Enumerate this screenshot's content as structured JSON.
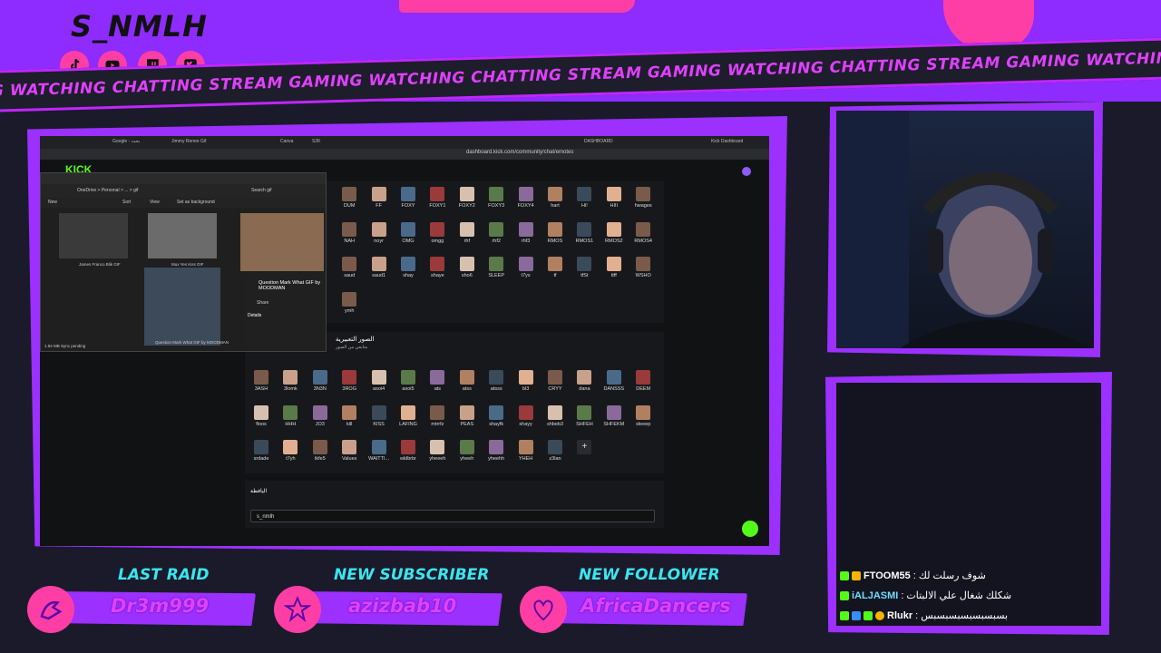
{
  "overlay": {
    "logo": "S_NMLH",
    "ticker_text": "G WATCHING CHATTING STREAM GAMING WATCHING CHATTING STREAM GAMING WATCHING CHATTING STREAM GAMING WATCHING CHATTING STREAM GAMING WATCHING",
    "socials": [
      "tiktok-icon",
      "youtube-icon",
      "twitch-icon",
      "kick-icon"
    ],
    "accent_color": "#9b30ff",
    "pink_color": "#ff3ea5",
    "cyan_color": "#39e6f0"
  },
  "alerts": {
    "last_raid": {
      "title": "LAST RAID",
      "name": "Dr3m999"
    },
    "new_subscriber": {
      "title": "NEW SUBSCRIBER",
      "name": "azizbab10"
    },
    "new_follower": {
      "title": "NEW FOLLOWER",
      "name": "AfricaDancers"
    }
  },
  "chat": [
    {
      "user": "FTOOM55",
      "message": "شوف رسلت لك"
    },
    {
      "user": "iALJASMI",
      "message": "شكلك شغال علي الالبتات"
    },
    {
      "user": "Rlukr",
      "message": "بسبسبسبسبسبسبس"
    }
  ],
  "browser": {
    "url": "dashboard.kick.com/community/chat/emotes",
    "kick_logo": "KICK",
    "tabs": [
      "Google - بحث",
      "Jimmy Renee Gif",
      "Canva",
      "S2K",
      "DASHBOARD",
      "Kick Dashboard"
    ]
  },
  "emotes_section1": [
    "DUM",
    "FF",
    "FOXY",
    "FOXY1",
    "FOXY2",
    "FOXY3",
    "FOXY4",
    "hart",
    "Hi!",
    "HIII",
    "hwages",
    "NAH",
    "noyr",
    "OMG",
    "omgg",
    "rhf",
    "rhf2",
    "rhf3",
    "RMOS",
    "RMOS1",
    "RMOS2",
    "RMOS4",
    "saud",
    "saud1",
    "shay",
    "shaye",
    "sho6",
    "SLEEP",
    "t7ys",
    "tf",
    "tfSt",
    "ttff",
    "WSHO",
    "ymh"
  ],
  "emotes_section2_title": "الصور التعبيرية",
  "emotes_section2_sub": "متابعي من الصور",
  "emotes_section2": [
    "3ASH",
    "3lomk",
    "3N3N",
    "3ROG",
    "asoi4",
    "asoi5",
    "ats",
    "atss",
    "atsss",
    "bl3",
    "CRYY",
    "dana",
    "DANSSS",
    "DEEM",
    "floos",
    "HHH",
    "JO3",
    "kill",
    "KISS",
    "LAFING",
    "mtrrfz",
    "PEAS",
    "shayfk",
    "shayy",
    "shbeb3",
    "SHFEH",
    "SHFEKM",
    "sleeep",
    "srdade",
    "t7yh",
    "tkfe5",
    "Values",
    "WAITTI...",
    "wldbrbr",
    "yheeeh",
    "yheeh",
    "yheehh",
    "YHEH",
    "z3lan"
  ],
  "username_label": "اليافطة",
  "username_value": "s_nmlh",
  "explorer": {
    "path": "OneDrive > Personal > ... > gif",
    "search_placeholder": "Search gif",
    "toolbar": [
      "New",
      "Sort",
      "View",
      "Set as background"
    ],
    "files": [
      "James Franco Blik GIF",
      "Mux Yes Kiss GIF",
      "Question Mark What GIF by MOODMAN"
    ],
    "details_title": "Question Mark What GIF by MOODMAN",
    "details_header": "Details",
    "share": "Share",
    "status": "1.94 MB   Sync pending"
  }
}
